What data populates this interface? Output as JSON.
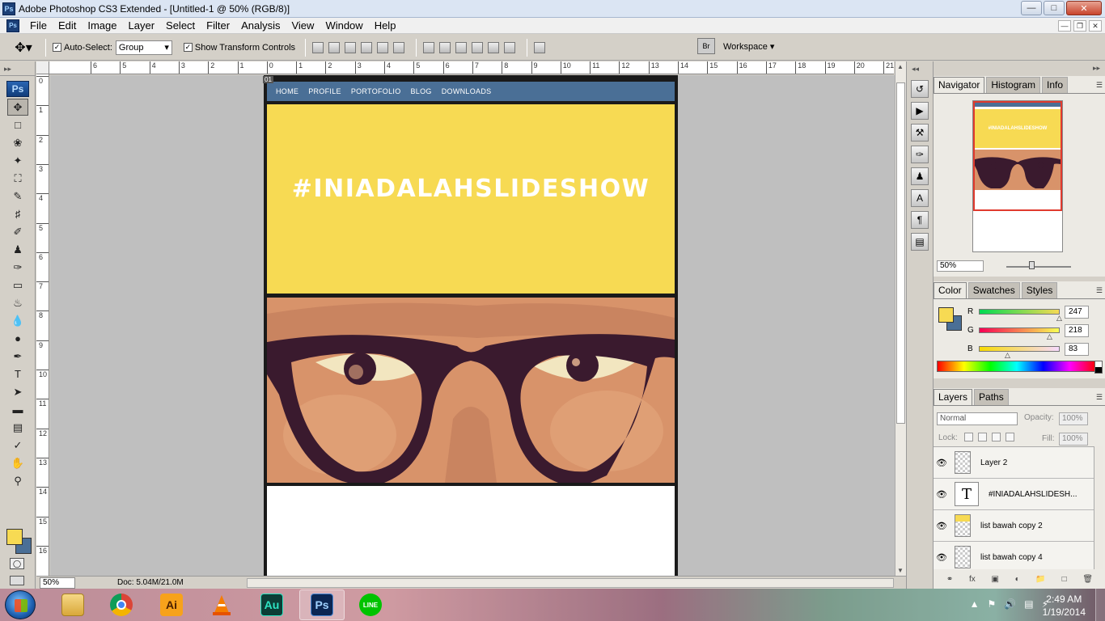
{
  "window": {
    "title": "Adobe Photoshop CS3 Extended - [Untitled-1 @ 50% (RGB/8)]",
    "app_icon": "Ps",
    "buttons": [
      "minimize",
      "maximize",
      "close"
    ]
  },
  "menu": {
    "items": [
      "File",
      "Edit",
      "Image",
      "Layer",
      "Select",
      "Filter",
      "Analysis",
      "View",
      "Window",
      "Help"
    ]
  },
  "options": {
    "auto_select_label": "Auto-Select:",
    "auto_select_checked": true,
    "auto_select_value": "Group",
    "show_transform_label": "Show Transform Controls",
    "show_transform_checked": true,
    "workspace_label": "Workspace"
  },
  "toolbox": {
    "logo": "Ps",
    "foreground_color": "#f7da53",
    "background_color": "#4a6f96"
  },
  "rulers": {
    "top": [
      "6",
      "5",
      "4",
      "3",
      "2",
      "1",
      "0",
      "1",
      "2",
      "3",
      "4",
      "5",
      "6",
      "7",
      "8",
      "9",
      "10",
      "11",
      "12",
      "13",
      "14",
      "15",
      "16",
      "17",
      "18",
      "19",
      "20",
      "21"
    ],
    "left": [
      "0",
      "1",
      "2",
      "3",
      "4",
      "5",
      "6",
      "7",
      "8",
      "9",
      "10",
      "11",
      "12",
      "13",
      "14",
      "15",
      "16"
    ]
  },
  "document": {
    "artboard_tag": "01",
    "nav_links": [
      "HOME",
      "PROFILE",
      "PORTOFOLIO",
      "BLOG",
      "DOWNLOADS"
    ],
    "slide_title": "#INIADALAHSLIDESHOW",
    "colors": {
      "nav": "#4a6f96",
      "slide": "#f7da53",
      "skin": "#d8936a",
      "frames": "#3a1a2e"
    }
  },
  "status": {
    "zoom": "50%",
    "doc_info": "Doc: 5.04M/21.0M"
  },
  "navigator_panel": {
    "tabs": [
      "Navigator",
      "Histogram",
      "Info"
    ],
    "zoom": "50%",
    "thumb_title": "#INIADALAHSLIDESHOW"
  },
  "color_panel": {
    "tabs": [
      "Color",
      "Swatches",
      "Styles"
    ],
    "channels": [
      {
        "label": "R",
        "value": "247"
      },
      {
        "label": "G",
        "value": "218"
      },
      {
        "label": "B",
        "value": "83"
      }
    ]
  },
  "layers_panel": {
    "tabs": [
      "Layers",
      "Paths"
    ],
    "blend_mode": "Normal",
    "opacity_label": "Opacity:",
    "opacity": "100%",
    "lock_label": "Lock:",
    "fill_label": "Fill:",
    "fill": "100%",
    "layers": [
      {
        "name": "Layer 2",
        "type": "raster"
      },
      {
        "name": "#INIADALAHSLIDESH...",
        "type": "text"
      },
      {
        "name": "list bawah copy 2",
        "type": "raster-yellow"
      },
      {
        "name": "list bawah copy 4",
        "type": "raster"
      }
    ]
  },
  "taskbar": {
    "apps": [
      "explorer",
      "chrome",
      "illustrator",
      "vlc",
      "audition",
      "photoshop",
      "line"
    ],
    "app_labels": {
      "illustrator": "Ai",
      "audition": "Au",
      "photoshop": "Ps",
      "line": "LINE"
    },
    "time": "2:49 AM",
    "date": "1/19/2014"
  }
}
